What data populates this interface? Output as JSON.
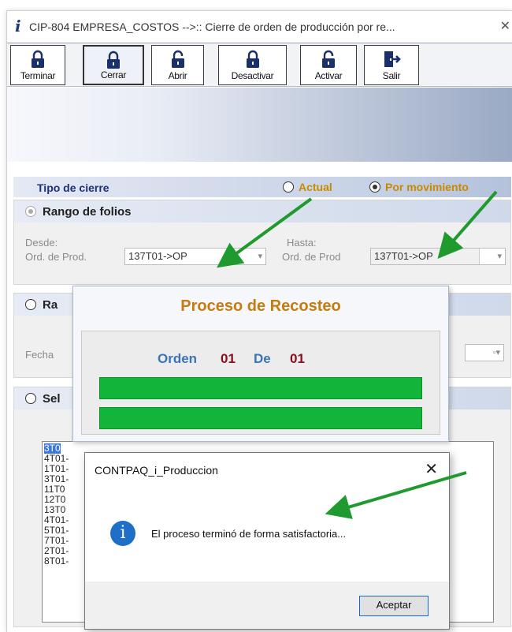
{
  "window": {
    "title": "CIP-804 EMPRESA_COSTOS -->:: Cierre de orden de producción por re...",
    "icon": "info-icon",
    "close_glyph": "✕"
  },
  "toolbar": {
    "buttons": [
      {
        "label": "Terminar",
        "icon": "lock-closed-icon"
      },
      {
        "label": "Cerrar",
        "icon": "lock-closed-icon"
      },
      {
        "label": "Abrir",
        "icon": "lock-open-icon"
      },
      {
        "label": "Desactivar",
        "icon": "lock-closed-icon"
      },
      {
        "label": "Activar",
        "icon": "lock-open-icon"
      },
      {
        "label": "Salir",
        "icon": "exit-door-icon"
      }
    ]
  },
  "tipo_cierre": {
    "label": "Tipo de cierre",
    "option_actual": "Actual",
    "option_movimiento": "Por movimiento",
    "selected": "Por movimiento"
  },
  "rango_folios": {
    "title": "Rango de folios",
    "desde_label": "Desde:",
    "desde_field_label": "Ord. de Prod.",
    "desde_value": "137T01->OP",
    "hasta_label": "Hasta:",
    "hasta_field_label": "Ord. de Prod",
    "hasta_value": "137T01->OP"
  },
  "rango_fechas": {
    "title_partial": "Ra",
    "fecha_label": "Fecha"
  },
  "seleccion": {
    "title_partial": "Sel",
    "items": [
      "3T0",
      "4T01-",
      "1T01-",
      "3T01-",
      "11T0",
      "12T0",
      "13T0",
      "4T01-",
      "5T01-",
      "7T01-",
      "2T01-",
      "8T01-"
    ]
  },
  "progress_dialog": {
    "title": "Proceso de Recosteo",
    "orden_label": "Orden",
    "orden_value": "01",
    "de_label": "De",
    "de_value": "01",
    "progress_1": 1.0,
    "progress_2": 1.0
  },
  "message_dialog": {
    "title": "CONTPAQ_i_Produccion",
    "close_glyph": "✕",
    "icon": "info-icon",
    "message": "El proceso terminó de forma satisfactoria...",
    "ok_label": "Aceptar"
  },
  "colors": {
    "accent_orange": "#c47d0e",
    "progress_green": "#13b43a",
    "arrow_green": "#1f9a2e",
    "header_blue": "#1f2f78",
    "orden_blue": "#3a73b8",
    "orden_red": "#8a1020"
  }
}
